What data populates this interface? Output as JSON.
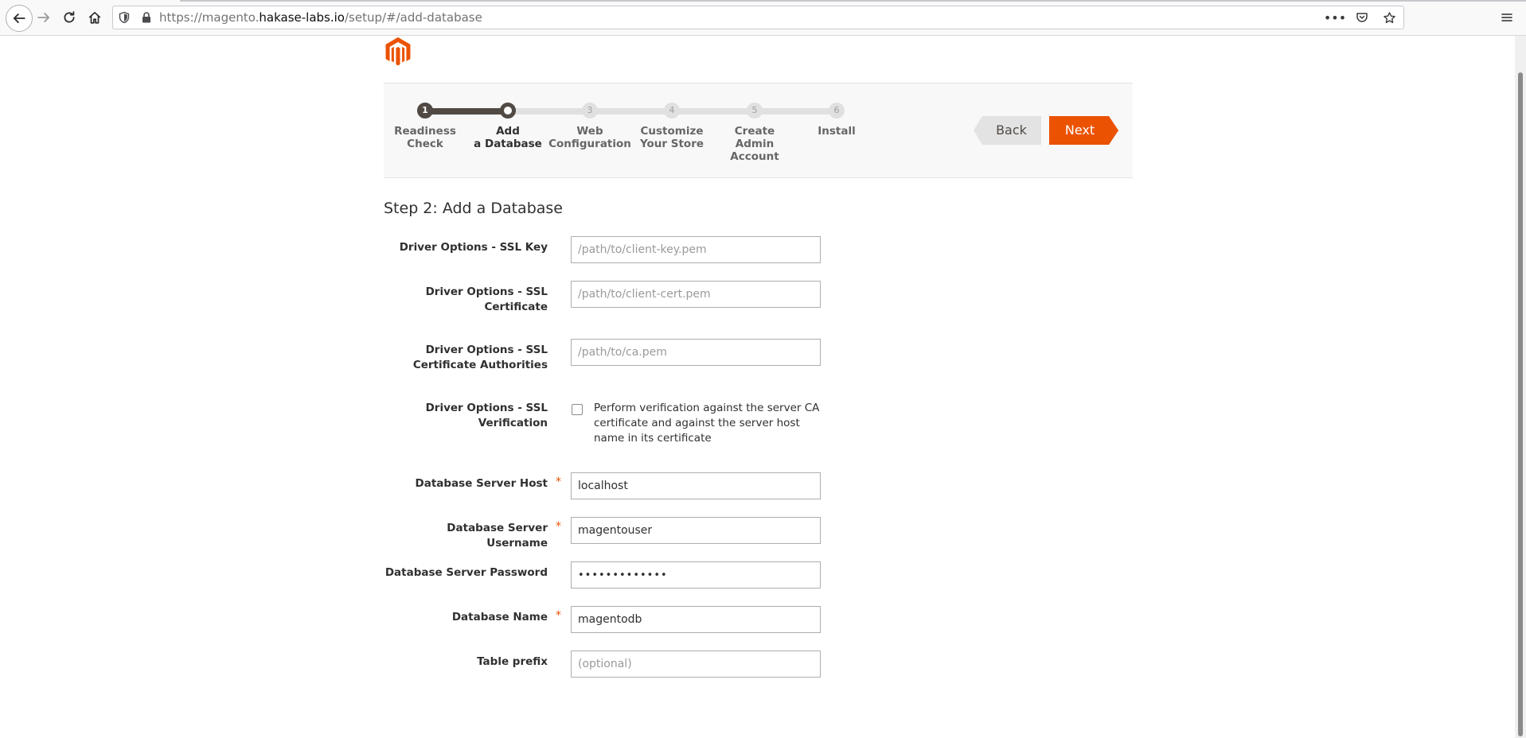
{
  "browser": {
    "url_prefix": "https://magento.",
    "url_host": "hakase-labs.io",
    "url_path": "/setup/#/add-database",
    "icons": [
      "back-icon",
      "forward-icon",
      "reload-icon",
      "home-icon",
      "shield-icon",
      "lock-icon",
      "more-icon",
      "pocket-icon",
      "star-icon",
      "menu-icon"
    ]
  },
  "progress": {
    "steps": [
      {
        "num": "1",
        "line1": "Readiness",
        "line2": "Check",
        "line3": ""
      },
      {
        "num": "2",
        "line1": "Add",
        "line2": "a Database",
        "line3": ""
      },
      {
        "num": "3",
        "line1": "Web",
        "line2": "Configuration",
        "line3": ""
      },
      {
        "num": "4",
        "line1": "Customize",
        "line2": "Your Store",
        "line3": ""
      },
      {
        "num": "5",
        "line1": "Create",
        "line2": "Admin",
        "line3": "Account"
      },
      {
        "num": "6",
        "line1": "Install",
        "line2": "",
        "line3": ""
      }
    ],
    "current_step": 2,
    "back_label": "Back",
    "next_label": "Next"
  },
  "colors": {
    "accent": "#eb5202",
    "step_done": "#514943",
    "step_pending": "#e1e0e0"
  },
  "page": {
    "title": "Step 2: Add a Database"
  },
  "form": {
    "ssl_key": {
      "label": "Driver Options - SSL Key",
      "placeholder": "/path/to/client-key.pem",
      "value": ""
    },
    "ssl_cert": {
      "label_line1": "Driver Options - SSL",
      "label_line2": "Certificate",
      "placeholder": "/path/to/client-cert.pem",
      "value": ""
    },
    "ssl_ca": {
      "label_line1": "Driver Options - SSL",
      "label_line2": "Certificate Authorities",
      "placeholder": "/path/to/ca.pem",
      "value": ""
    },
    "ssl_verify": {
      "label_line1": "Driver Options - SSL",
      "label_line2": "Verification",
      "checkbox_text": "Perform verification against the server CA certificate and against the server host name in its certificate",
      "checked": false
    },
    "db_host": {
      "label": "Database Server Host",
      "required_mark": "*",
      "value": "localhost"
    },
    "db_user": {
      "label": "Database Server Username",
      "required_mark": "*",
      "value": "magentouser"
    },
    "db_password": {
      "label": "Database Server Password",
      "value": "•••••••••••••"
    },
    "db_name": {
      "label": "Database Name",
      "required_mark": "*",
      "value": "magentodb"
    },
    "table_prefix": {
      "label": "Table prefix",
      "placeholder": "(optional)",
      "value": ""
    }
  }
}
